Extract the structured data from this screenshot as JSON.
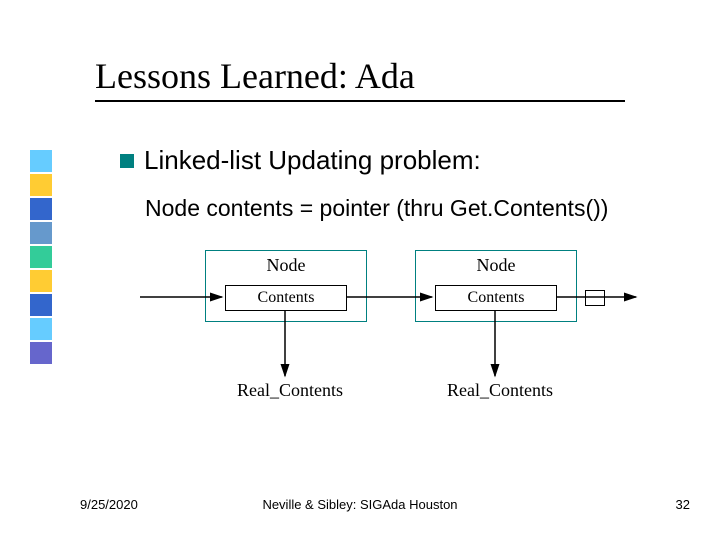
{
  "title": "Lessons Learned: Ada",
  "bullet": "Linked-list Updating problem:",
  "subline": "Node contents = pointer (thru Get.Contents())",
  "diagram": {
    "node_label": "Node",
    "contents_label": "Contents",
    "real_label": "Real_Contents"
  },
  "footer": {
    "date": "9/25/2020",
    "center": "Neville & Sibley: SIGAda Houston",
    "page": "32"
  },
  "sidebar_colors": [
    "#66ccff",
    "#ffcc33",
    "#3366cc",
    "#6699cc",
    "#33cc99",
    "#ffcc33",
    "#3366cc",
    "#66ccff",
    "#6666cc"
  ]
}
